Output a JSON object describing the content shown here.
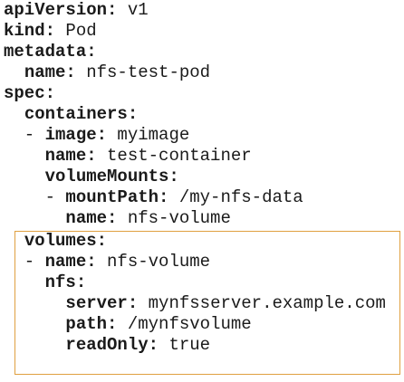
{
  "highlight": {
    "border_color": "#e0a040"
  },
  "lines": [
    {
      "indent": "",
      "key": "apiVersion:",
      "value": " v1"
    },
    {
      "indent": "",
      "key": "kind:",
      "value": " Pod"
    },
    {
      "indent": "",
      "key": "metadata:",
      "value": ""
    },
    {
      "indent": "  ",
      "key": "name:",
      "value": " nfs-test-pod"
    },
    {
      "indent": "",
      "key": "spec:",
      "value": ""
    },
    {
      "indent": "  ",
      "key": "containers:",
      "value": ""
    },
    {
      "indent": "  - ",
      "key": "image:",
      "value": " myimage"
    },
    {
      "indent": "    ",
      "key": "name:",
      "value": " test-container"
    },
    {
      "indent": "    ",
      "key": "volumeMounts:",
      "value": ""
    },
    {
      "indent": "    - ",
      "key": "mountPath:",
      "value": " /my-nfs-data"
    },
    {
      "indent": "      ",
      "key": "name:",
      "value": " nfs-volume"
    },
    {
      "indent": "  ",
      "key": "volumes:",
      "value": ""
    },
    {
      "indent": "  - ",
      "key": "name:",
      "value": " nfs-volume"
    },
    {
      "indent": "    ",
      "key": "nfs:",
      "value": ""
    },
    {
      "indent": "      ",
      "key": "server:",
      "value": " mynfsserver.example.com"
    },
    {
      "indent": "      ",
      "key": "path:",
      "value": " /mynfsvolume"
    },
    {
      "indent": "      ",
      "key": "readOnly:",
      "value": " true"
    }
  ]
}
